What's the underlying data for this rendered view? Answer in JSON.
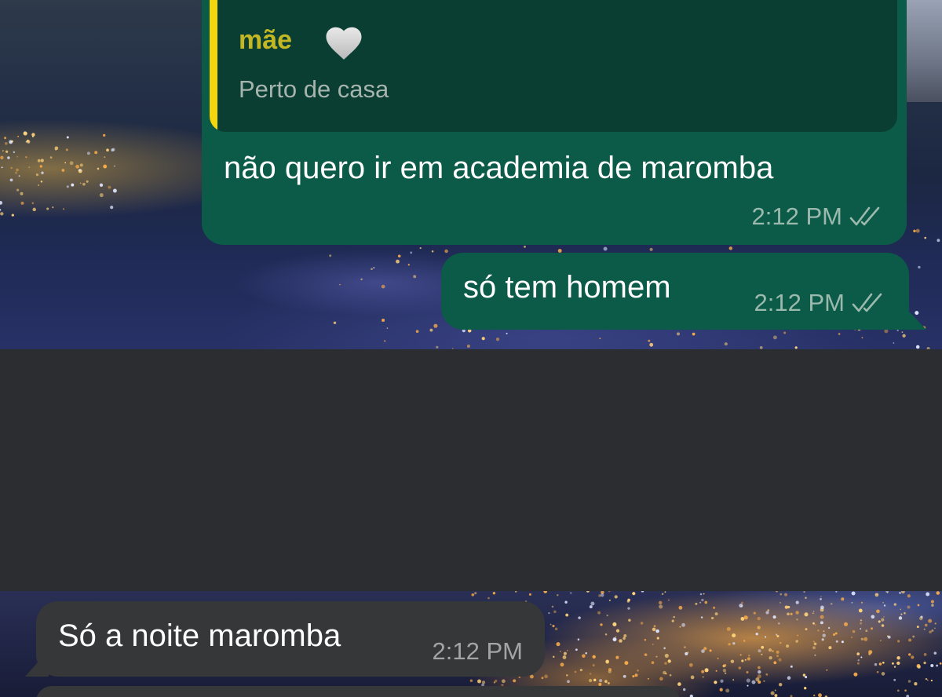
{
  "colors": {
    "outgoing_bubble": "#0b5b48",
    "reply_quote_bg": "#0a3e33",
    "reply_bar": "#f5d50b",
    "reply_sender": "#c3b824",
    "incoming_bubble": "#353739",
    "gap_band": "#2b2d30"
  },
  "messages": [
    {
      "direction": "outgoing",
      "reply": {
        "sender": "mãe",
        "sender_icon": "white-heart-icon",
        "snippet": "Perto de casa"
      },
      "text": "não quero ir em academia de maromba",
      "time": "2:12 PM",
      "status_icon": "double-check-icon"
    },
    {
      "direction": "outgoing",
      "text": "só tem homem",
      "time": "2:12 PM",
      "status_icon": "double-check-icon"
    },
    {
      "direction": "incoming",
      "text": "Só a noite maromba",
      "time": "2:12 PM"
    }
  ],
  "background": {
    "icon": "night-city-wallpaper"
  }
}
